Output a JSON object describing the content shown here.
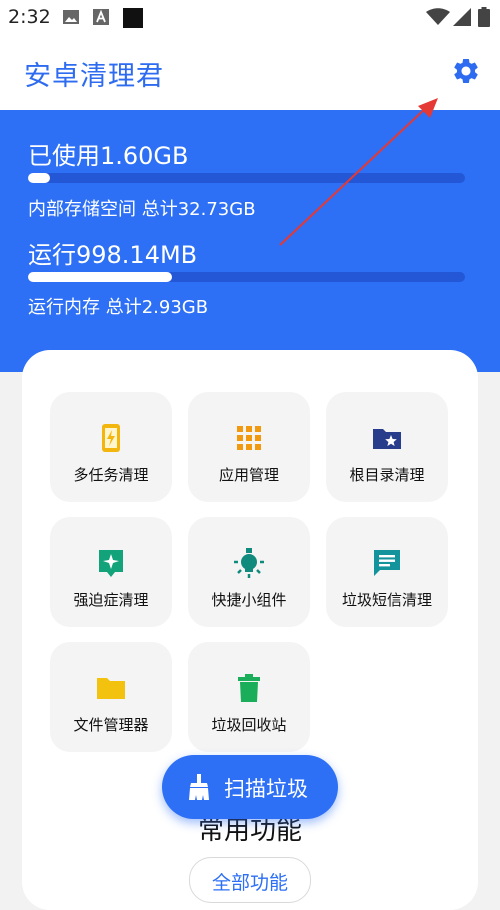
{
  "status": {
    "time": "2:32"
  },
  "app": {
    "title": "安卓清理君"
  },
  "storage": {
    "used_label": "已使用1.60GB",
    "total_label": "内部存储空间 总计32.73GB",
    "used_fraction": 0.05
  },
  "memory": {
    "used_label": "运行998.14MB",
    "total_label": "运行内存 总计2.93GB",
    "used_fraction": 0.33
  },
  "tools": [
    {
      "label": "多任务清理",
      "icon": "phone-charge-icon",
      "color": "#f2b60f"
    },
    {
      "label": "应用管理",
      "icon": "apps-grid-icon",
      "color": "#f29a0f"
    },
    {
      "label": "根目录清理",
      "icon": "folder-star-icon",
      "color": "#283c8c"
    },
    {
      "label": "强迫症清理",
      "icon": "sparkle-badge-icon",
      "color": "#13a37a"
    },
    {
      "label": "快捷小组件",
      "icon": "lightbulb-icon",
      "color": "#0f8a7c"
    },
    {
      "label": "垃圾短信清理",
      "icon": "message-icon",
      "color": "#13939c"
    },
    {
      "label": "文件管理器",
      "icon": "folder-icon",
      "color": "#f2c20f"
    },
    {
      "label": "垃圾回收站",
      "icon": "trash-icon",
      "color": "#1aad5a"
    }
  ],
  "scan": {
    "label": "扫描垃圾"
  },
  "common": {
    "title": "常用功能",
    "all_label": "全部功能"
  }
}
